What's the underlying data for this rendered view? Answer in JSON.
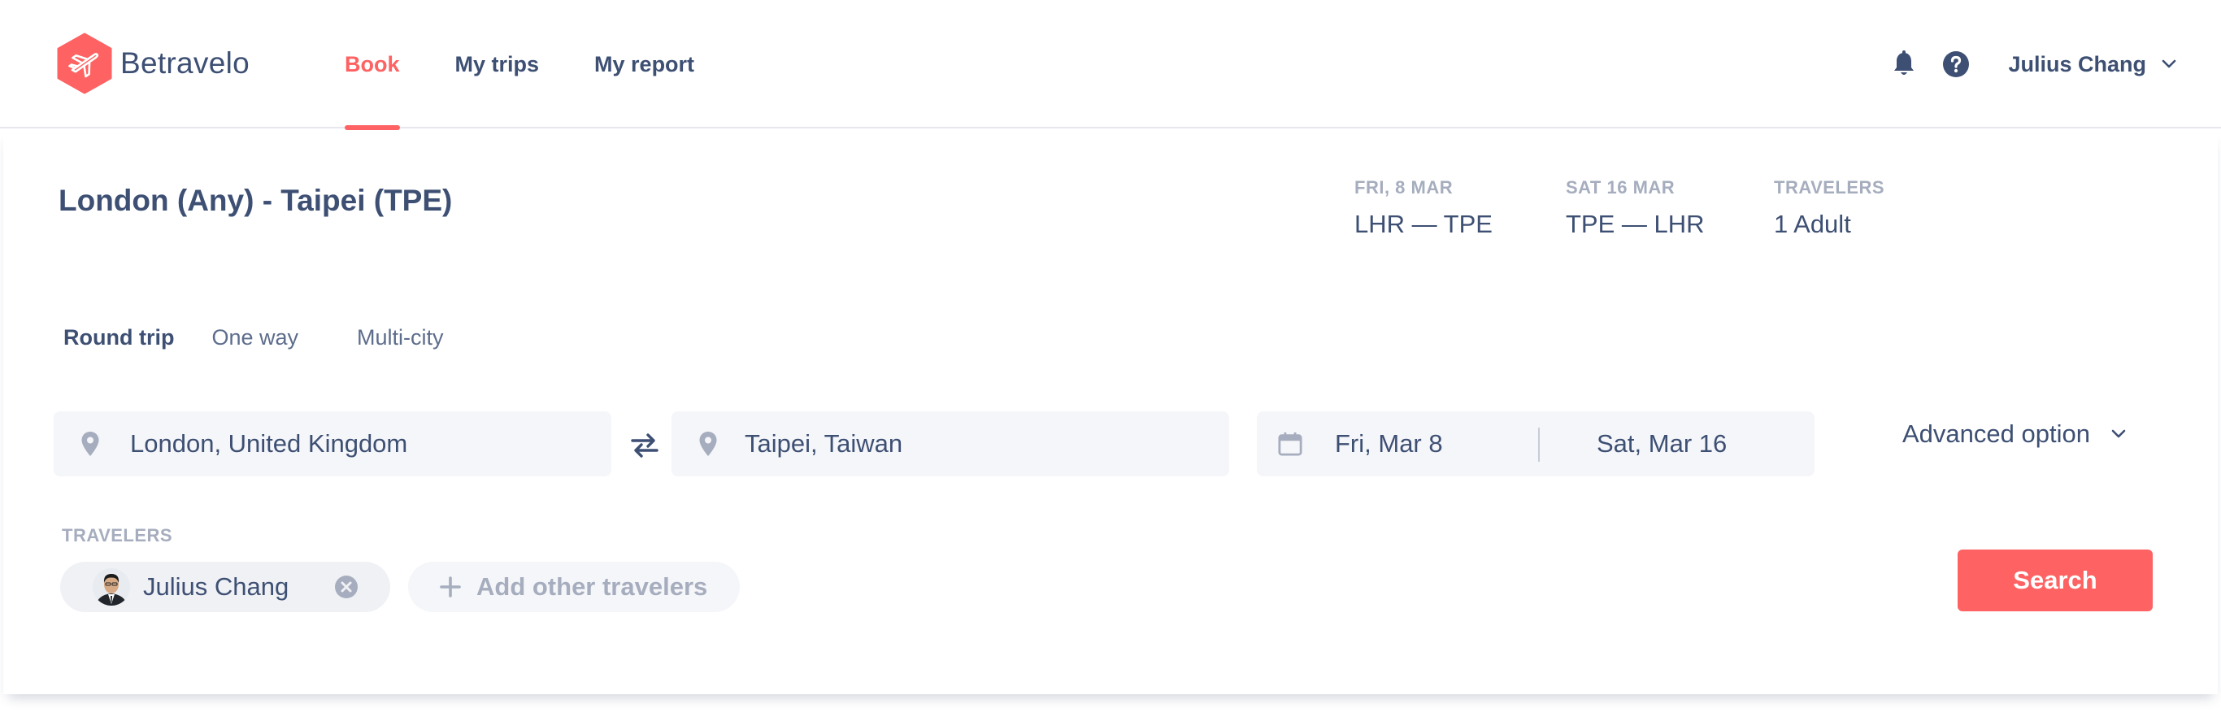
{
  "brand": {
    "name": "Betravelo",
    "accent": "#fe6262",
    "text": "#3d4f73",
    "muted": "#a6adbe",
    "field_bg": "#f5f6f9"
  },
  "nav": {
    "items": [
      {
        "label": "Book",
        "active": true
      },
      {
        "label": "My trips",
        "active": false
      },
      {
        "label": "My report",
        "active": false
      }
    ]
  },
  "header_right": {
    "icons": [
      "bell-icon",
      "help-icon"
    ],
    "user_name": "Julius Chang"
  },
  "trip": {
    "title": "London (Any) - Taipei (TPE)",
    "summary": [
      {
        "label": "FRI, 8 MAR",
        "value": "LHR — TPE"
      },
      {
        "label": "SAT 16 MAR",
        "value": "TPE — LHR"
      },
      {
        "label": "TRAVELERS",
        "value": "1 Adult"
      }
    ]
  },
  "trip_types": [
    {
      "label": "Round trip",
      "active": true
    },
    {
      "label": "One way",
      "active": false
    },
    {
      "label": "Multi-city",
      "active": false
    }
  ],
  "search_form": {
    "origin": "London, United Kingdom",
    "destination": "Taipei, Taiwan",
    "depart_date": "Fri, Mar 8",
    "return_date": "Sat, Mar 16",
    "advanced_option": "Advanced option",
    "travelers_label": "TRAVELERS",
    "travelers": [
      {
        "name": "Julius Chang"
      }
    ],
    "add_travelers": "Add other travelers",
    "search_button": "Search"
  }
}
